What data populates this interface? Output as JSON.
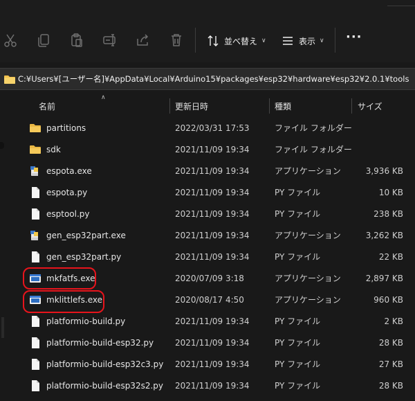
{
  "toolbar": {
    "sort_label": "並べ替え",
    "view_label": "表示",
    "icons": [
      "cut-icon",
      "copy-icon",
      "paste-icon",
      "rename-icon",
      "share-icon",
      "delete-icon",
      "sort-icon",
      "view-icon",
      "more-icon"
    ]
  },
  "address": {
    "path": "C:¥Users¥[ユーザー名]¥AppData¥Local¥Arduino15¥packages¥esp32¥hardware¥esp32¥2.0.1¥tools"
  },
  "columns": {
    "name": "名前",
    "date": "更新日時",
    "type": "種類",
    "size": "サイズ"
  },
  "files": [
    {
      "name": "partitions",
      "date": "2022/03/31 17:53",
      "type": "ファイル フォルダー",
      "size": "",
      "icon": "folder"
    },
    {
      "name": "sdk",
      "date": "2021/11/09 19:34",
      "type": "ファイル フォルダー",
      "size": "",
      "icon": "folder"
    },
    {
      "name": "espota.exe",
      "date": "2021/11/09 19:34",
      "type": "アプリケーション",
      "size": "3,936 KB",
      "icon": "python-exe"
    },
    {
      "name": "espota.py",
      "date": "2021/11/09 19:34",
      "type": "PY ファイル",
      "size": "10 KB",
      "icon": "document"
    },
    {
      "name": "esptool.py",
      "date": "2021/11/09 19:34",
      "type": "PY ファイル",
      "size": "238 KB",
      "icon": "document"
    },
    {
      "name": "gen_esp32part.exe",
      "date": "2021/11/09 19:34",
      "type": "アプリケーション",
      "size": "3,262 KB",
      "icon": "python-exe"
    },
    {
      "name": "gen_esp32part.py",
      "date": "2021/11/09 19:34",
      "type": "PY ファイル",
      "size": "22 KB",
      "icon": "document"
    },
    {
      "name": "mkfatfs.exe",
      "date": "2020/07/09 3:18",
      "type": "アプリケーション",
      "size": "2,897 KB",
      "icon": "app-exe"
    },
    {
      "name": "mklittlefs.exe",
      "date": "2020/08/17 4:50",
      "type": "アプリケーション",
      "size": "960 KB",
      "icon": "app-exe"
    },
    {
      "name": "platformio-build.py",
      "date": "2021/11/09 19:34",
      "type": "PY ファイル",
      "size": "2 KB",
      "icon": "document"
    },
    {
      "name": "platformio-build-esp32.py",
      "date": "2021/11/09 19:34",
      "type": "PY ファイル",
      "size": "28 KB",
      "icon": "document"
    },
    {
      "name": "platformio-build-esp32c3.py",
      "date": "2021/11/09 19:34",
      "type": "PY ファイル",
      "size": "27 KB",
      "icon": "document"
    },
    {
      "name": "platformio-build-esp32s2.py",
      "date": "2021/11/09 19:34",
      "type": "PY ファイル",
      "size": "28 KB",
      "icon": "document"
    }
  ],
  "colors": {
    "background": "#191919",
    "toolbar": "#1c1c1c",
    "address_bar": "#2b2b2b",
    "folder": "#f2c14e",
    "highlight_circle": "#e8141c"
  }
}
